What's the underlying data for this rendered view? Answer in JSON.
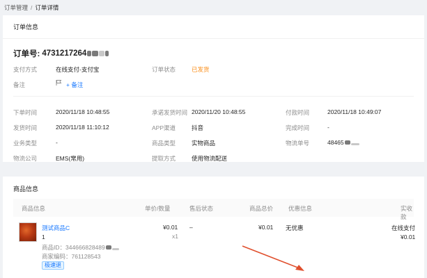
{
  "breadcrumb": {
    "parent": "订单管理",
    "separator": "/",
    "current": "订单详情"
  },
  "order_card": {
    "title": "订单信息",
    "order_no_label": "订单号:",
    "order_no_value": "4731217264",
    "rows1": [
      {
        "label": "支付方式",
        "value": "在线支付-支付宝"
      },
      {
        "label": "订单状态",
        "value": "已发货"
      }
    ],
    "note": {
      "label": "备注",
      "action": "+ 备注"
    },
    "rows2": [
      [
        {
          "label": "下单时间",
          "value": "2020/11/18 10:48:55"
        },
        {
          "label": "承诺发货时间",
          "value": "2020/11/20 10:48:55"
        },
        {
          "label": "付款时间",
          "value": "2020/11/18 10:49:07"
        }
      ],
      [
        {
          "label": "发货时间",
          "value": "2020/11/18 11:10:12"
        },
        {
          "label": "APP渠道",
          "value": "抖音"
        },
        {
          "label": "完成时间",
          "value": "-"
        }
      ],
      [
        {
          "label": "业务类型",
          "value": "-"
        },
        {
          "label": "商品类型",
          "value": "实物商品"
        },
        {
          "label": "物流单号",
          "value": "48465"
        }
      ],
      [
        {
          "label": "物流公司",
          "value": "EMS(常用)"
        },
        {
          "label": "提取方式",
          "value": "使用物流配送"
        }
      ]
    ]
  },
  "goods_card": {
    "title": "商品信息",
    "headers": [
      "商品信息",
      "单价/数量",
      "售后状态",
      "商品总价",
      "优惠信息",
      "实收款"
    ],
    "item": {
      "name": "测试商品C",
      "qty_line": "1",
      "product_id": "商品ID：344666828489",
      "merchant_code": "商家编码：761128543",
      "tag": "极速退",
      "unit_price": "¥0.01",
      "quantity": "x1",
      "after_sale": "–",
      "total": "¥0.01",
      "discount": "无优惠",
      "pay_method": "在线支付",
      "paid": "¥0.01"
    }
  },
  "colors": {
    "accent": "#1677ff",
    "status": "#fa8c16",
    "annotation": "#e0502e"
  }
}
